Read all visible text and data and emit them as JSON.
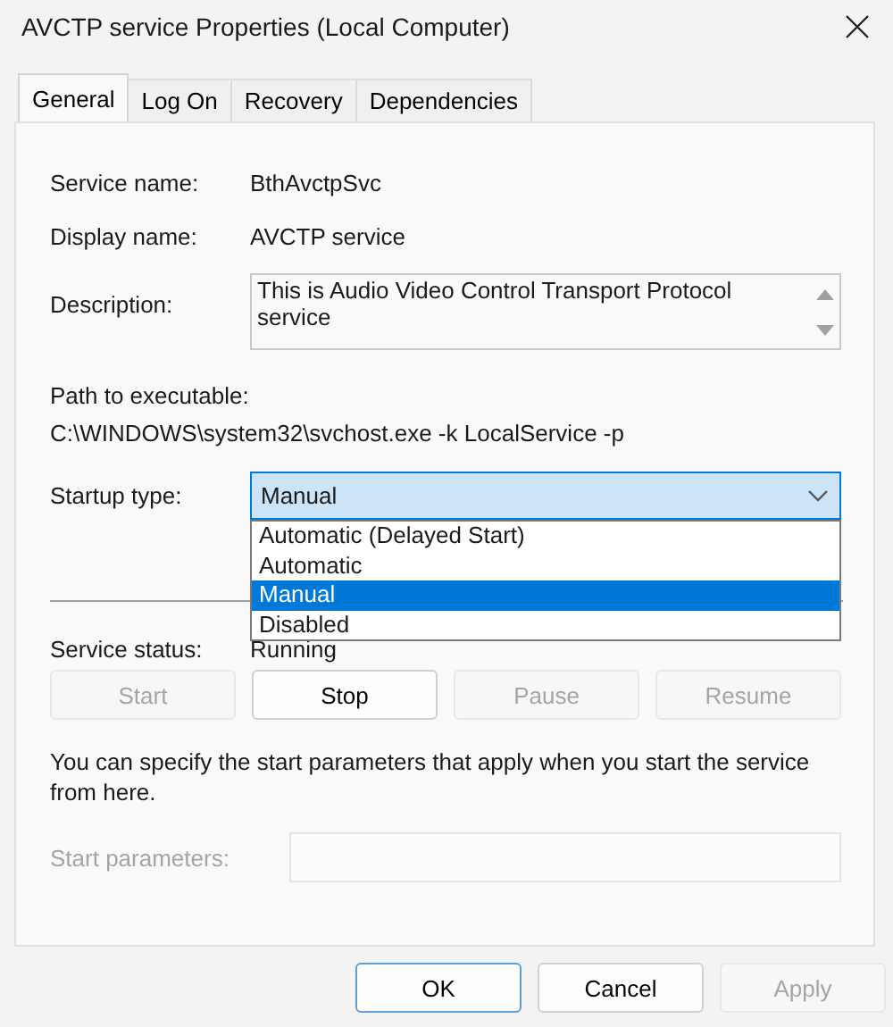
{
  "window": {
    "title": "AVCTP service Properties (Local Computer)"
  },
  "tabs": [
    {
      "label": "General",
      "selected": true
    },
    {
      "label": "Log On",
      "selected": false
    },
    {
      "label": "Recovery",
      "selected": false
    },
    {
      "label": "Dependencies",
      "selected": false
    }
  ],
  "fields": [
    {
      "label": "Service name:",
      "value": "BthAvctpSvc"
    },
    {
      "label": "Display name:",
      "value": "AVCTP service"
    }
  ],
  "description": {
    "label": "Description:",
    "value": "This is Audio Video Control Transport Protocol service"
  },
  "path": {
    "label": "Path to executable:",
    "value": "C:\\WINDOWS\\system32\\svchost.exe -k LocalService -p"
  },
  "startup_type": {
    "label": "Startup type:",
    "value": "Manual",
    "expanded": true,
    "options": [
      {
        "label": "Automatic (Delayed Start)",
        "selected": false
      },
      {
        "label": "Automatic",
        "selected": false
      },
      {
        "label": "Manual",
        "selected": true
      },
      {
        "label": "Disabled",
        "selected": false
      }
    ]
  },
  "service_status": {
    "label": "Service status:",
    "value": "Running"
  },
  "control_buttons": [
    {
      "label": "Start",
      "disabled": true
    },
    {
      "label": "Stop",
      "disabled": false
    },
    {
      "label": "Pause",
      "disabled": true
    },
    {
      "label": "Resume",
      "disabled": true
    }
  ],
  "hint": "You can specify the start parameters that apply when you start the service from here.",
  "start_parameters": {
    "label": "Start parameters:",
    "disabled": true
  },
  "buttons": [
    {
      "label": "OK",
      "disabled": false,
      "default": true
    },
    {
      "label": "Cancel",
      "disabled": false,
      "default": false
    },
    {
      "label": "Apply",
      "disabled": true,
      "default": false
    }
  ]
}
